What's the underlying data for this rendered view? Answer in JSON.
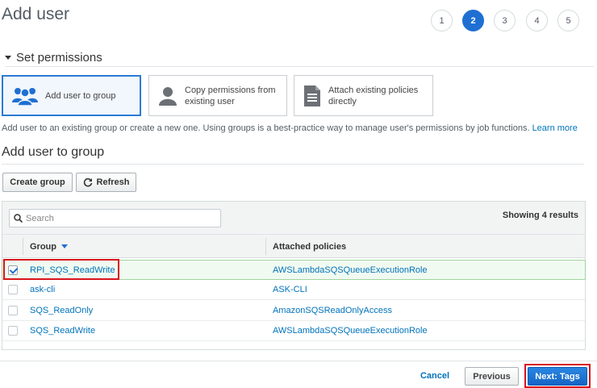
{
  "page": {
    "title": "Add user"
  },
  "stepper": {
    "steps": [
      "1",
      "2",
      "3",
      "4",
      "5"
    ],
    "active": "2"
  },
  "section": {
    "title": "Set permissions"
  },
  "options": [
    {
      "label": "Add user to group",
      "icon": "user-group-icon",
      "selected": true
    },
    {
      "label": "Copy permissions from existing user",
      "icon": "user-icon",
      "selected": false
    },
    {
      "label": "Attach existing policies directly",
      "icon": "document-icon",
      "selected": false
    }
  ],
  "description": {
    "text": "Add user to an existing group or create a new one. Using groups is a best-practice way to manage user's permissions by job functions.",
    "link": "Learn more"
  },
  "subsection": {
    "title": "Add user to group"
  },
  "toolbar": {
    "create_group": "Create group",
    "refresh": "Refresh",
    "refresh_icon": "refresh-icon"
  },
  "table": {
    "search_placeholder": "Search",
    "showing": "Showing 4 results",
    "columns": {
      "group": "Group",
      "policies": "Attached policies"
    },
    "rows": [
      {
        "group": "RPI_SQS_ReadWrite",
        "policy": "AWSLambdaSQSQueueExecutionRole",
        "checked": true
      },
      {
        "group": "ask-cli",
        "policy": "ASK-CLI",
        "checked": false
      },
      {
        "group": "SQS_ReadOnly",
        "policy": "AmazonSQSReadOnlyAccess",
        "checked": false
      },
      {
        "group": "SQS_ReadWrite",
        "policy": "AWSLambdaSQSQueueExecutionRole",
        "checked": false
      }
    ]
  },
  "footer": {
    "cancel": "Cancel",
    "previous": "Previous",
    "next": "Next: Tags"
  },
  "colors": {
    "accent": "#1f6fd3",
    "link": "#0073bb",
    "highlight": "#d9141c",
    "selected_row": "#f1faf1"
  }
}
